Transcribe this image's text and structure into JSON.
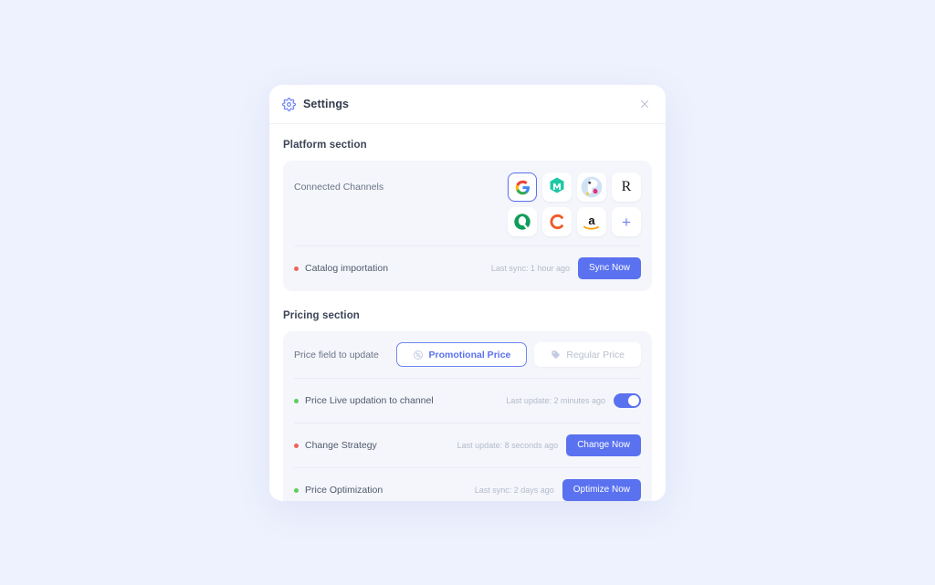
{
  "window": {
    "background_color": "#eef2fe",
    "card_color": "#ffffff"
  },
  "header": {
    "icon": "gear-icon",
    "title": "Settings",
    "close_icon": "close-icon"
  },
  "platform_section": {
    "title": "Platform section",
    "connected_channels": {
      "label": "Connected Channels",
      "channels": [
        {
          "name": "Google",
          "icon": "google-icon",
          "selected": true
        },
        {
          "name": "Mirakl",
          "icon": "mirakl-icon",
          "selected": false
        },
        {
          "name": "PrestaShop",
          "icon": "prestashop-icon",
          "selected": false
        },
        {
          "name": "Rakuten",
          "icon": "rakuten-icon",
          "selected": false
        },
        {
          "name": "Qoo10",
          "icon": "qoo10-icon",
          "selected": false
        },
        {
          "name": "Cdiscount",
          "icon": "cdiscount-icon",
          "selected": false
        },
        {
          "name": "Amazon",
          "icon": "amazon-icon",
          "selected": false
        },
        {
          "name": "Add channel",
          "icon": "plus-icon",
          "selected": false
        }
      ]
    },
    "catalog_importation": {
      "label": "Catalog importation",
      "status_color": "#f2615a",
      "meta": "Last sync: 1 hour ago",
      "button_label": "Sync Now"
    }
  },
  "pricing_section": {
    "title": "Pricing section",
    "price_field": {
      "label": "Price field to update",
      "options": [
        {
          "label": "Promotional Price",
          "icon": "discount-badge-icon",
          "selected": true
        },
        {
          "label": "Regular Price",
          "icon": "price-tag-icon",
          "selected": false
        }
      ]
    },
    "rows": [
      {
        "label": "Price Live updation to channel",
        "status_color": "#5ece5e",
        "meta": "Last update: 2 minutes ago",
        "control": "toggle",
        "toggle_on": true
      },
      {
        "label": "Change Strategy",
        "status_color": "#f2615a",
        "meta": "Last update: 8 seconds ago",
        "control": "button",
        "button_label": "Change Now"
      },
      {
        "label": "Price Optimization",
        "status_color": "#5ece5e",
        "meta": "Last sync: 2 days ago",
        "control": "button",
        "button_label": "Optimize Now"
      }
    ]
  },
  "colors": {
    "accent": "#5a72f0",
    "panel": "#f4f6fb",
    "status_red": "#f2615a",
    "status_green": "#5ece5e"
  }
}
